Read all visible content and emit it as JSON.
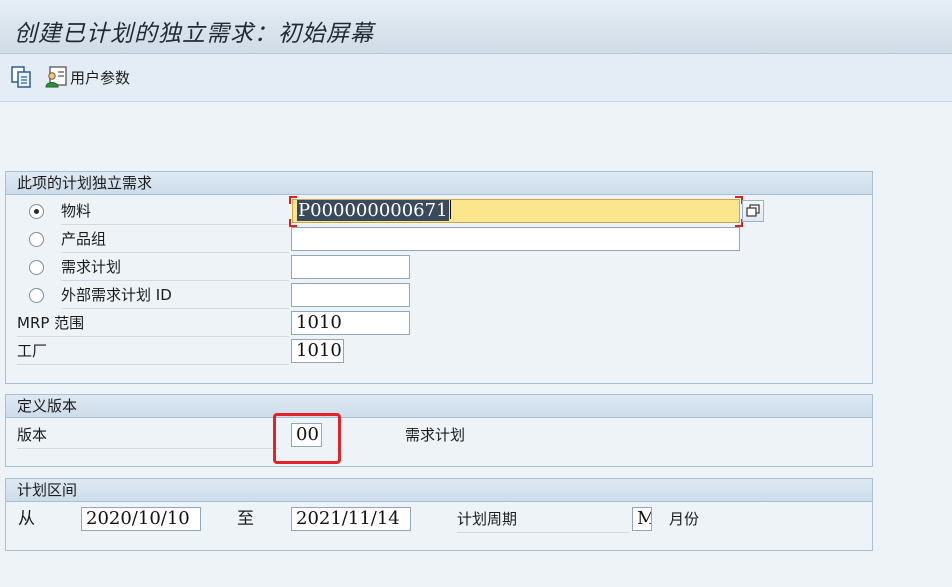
{
  "window": {
    "title": "创建已计划的独立需求：初始屏幕"
  },
  "toolbar": {
    "copy_icon": "copy-document-icon",
    "user_params_icon": "user-settings-icon",
    "user_params_label": "用户参数"
  },
  "group_requirements": {
    "title": "此项的计划独立需求",
    "options": [
      {
        "label": "物料",
        "selected": true,
        "value": "P000000000671"
      },
      {
        "label": "产品组",
        "selected": false,
        "value": ""
      },
      {
        "label": "需求计划",
        "selected": false,
        "value": ""
      },
      {
        "label": "外部需求计划 ID",
        "selected": false,
        "value": ""
      }
    ],
    "mrp_area_label": "MRP 范围",
    "mrp_area_value": "1010",
    "plant_label": "工厂",
    "plant_value": "1010"
  },
  "group_version": {
    "title": "定义版本",
    "version_label": "版本",
    "version_value": "00",
    "version_desc": "需求计划"
  },
  "group_period": {
    "title": "计划区间",
    "from_label": "从",
    "from_value": "2020/10/10",
    "to_label": "至",
    "to_value": "2021/11/14",
    "period_label": "计划周期",
    "period_value": "M",
    "period_desc": "月份"
  },
  "colors": {
    "focus_field": "#fbe58d",
    "highlight_box": "#e3222a",
    "header": "#cfdbe6"
  }
}
